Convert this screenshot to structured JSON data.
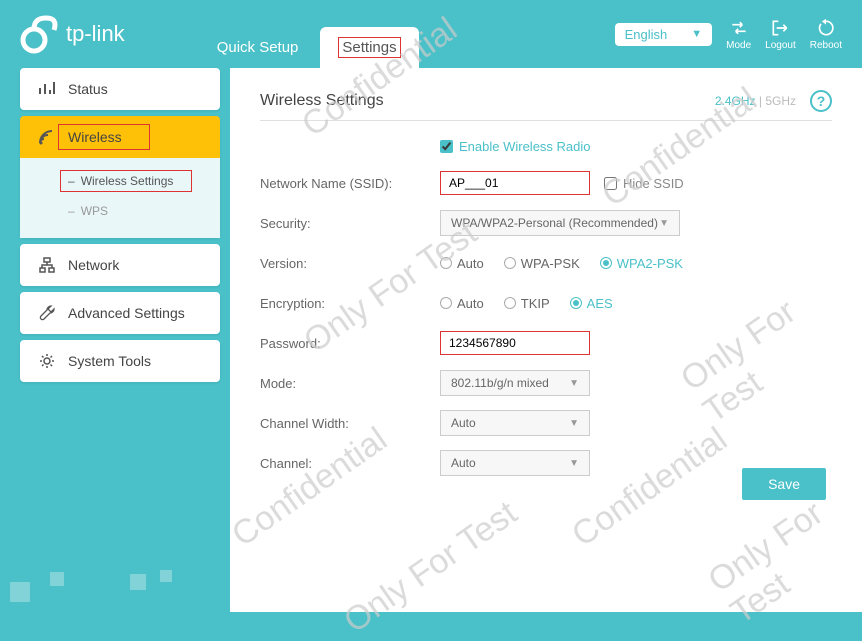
{
  "brand": "tp-link",
  "header": {
    "tabs": {
      "quick_setup": "Quick Setup",
      "settings": "Settings"
    },
    "lang": "English",
    "buttons": {
      "mode": "Mode",
      "logout": "Logout",
      "reboot": "Reboot"
    }
  },
  "sidebar": {
    "status": "Status",
    "wireless": "Wireless",
    "wireless_sub": {
      "settings": "Wireless Settings",
      "wps": "WPS"
    },
    "network": "Network",
    "advanced": "Advanced Settings",
    "system": "System Tools"
  },
  "panel": {
    "title": "Wireless Settings",
    "band_24": "2.4GHz",
    "band_sep": " | ",
    "band_5": "5GHz"
  },
  "form": {
    "enable_radio": "Enable Wireless Radio",
    "ssid_label": "Network Name (SSID):",
    "ssid_value": "AP___01",
    "hide_ssid": "Hide SSID",
    "security_label": "Security:",
    "security_value": "WPA/WPA2-Personal (Recommended)",
    "version_label": "Version:",
    "version_options": {
      "auto": "Auto",
      "wpa_psk": "WPA-PSK",
      "wpa2_psk": "WPA2-PSK"
    },
    "encryption_label": "Encryption:",
    "encryption_options": {
      "auto": "Auto",
      "tkip": "TKIP",
      "aes": "AES"
    },
    "password_label": "Password:",
    "password_value": "1234567890",
    "mode_label": "Mode:",
    "mode_value": "802.11b/g/n mixed",
    "channel_width_label": "Channel Width:",
    "channel_width_value": "Auto",
    "channel_label": "Channel:",
    "channel_value": "Auto"
  },
  "actions": {
    "save": "Save"
  },
  "watermarks": {
    "conf": "Confidential",
    "test": "Only For Test"
  }
}
